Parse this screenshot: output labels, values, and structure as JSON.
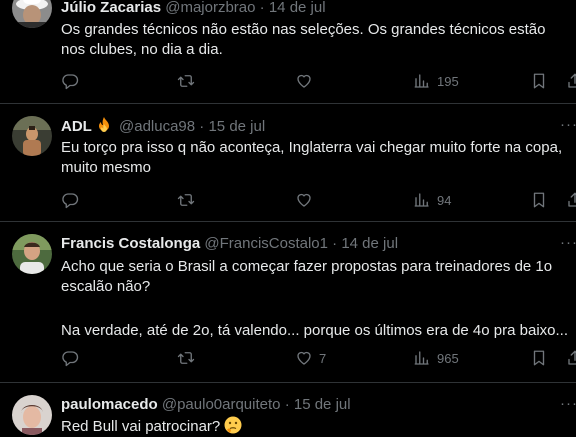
{
  "tweets": [
    {
      "name": "Júlio Zacarias",
      "handle": "@majorzbrao",
      "sep": "·",
      "date": "14 de jul",
      "more": "···",
      "lines": [
        "Os grandes técnicos não estão nas seleções. Os grandes técnicos estão",
        "nos clubes, no dia a dia."
      ],
      "replies": "",
      "retweets": "",
      "likes": "",
      "views": "195"
    },
    {
      "name": "ADL",
      "handle": "@adluca98",
      "sep": "·",
      "date": "15 de jul",
      "more": "···",
      "lines": [
        "Eu torço pra isso q não aconteça, Inglaterra vai chegar muito forte na copa,",
        "muito mesmo"
      ],
      "replies": "",
      "retweets": "",
      "likes": "",
      "views": "94"
    },
    {
      "name": "Francis Costalonga",
      "handle": "@FrancisCostalo1",
      "sep": "·",
      "date": "14 de jul",
      "more": "···",
      "lines": [
        "Acho que seria o Brasil a começar fazer propostas para treinadores de 1o",
        "escalão não?",
        "",
        "Na verdade, até de 2o, tá valendo... porque os últimos era de 4o pra baixo..."
      ],
      "replies": "",
      "retweets": "",
      "likes": "7",
      "views": "965"
    },
    {
      "name": "paulomacedo",
      "handle": "@paulo0arquiteto",
      "sep": "·",
      "date": "15 de jul",
      "more": "···",
      "lines": [
        "Red Bull vai patrocinar?"
      ]
    }
  ],
  "icons": {
    "reply": "reply-icon",
    "retweet": "retweet-icon",
    "like": "heart-icon",
    "views": "views-icon",
    "bookmark": "bookmark-icon",
    "fire": "fire-emoji",
    "thinking": "thinking-emoji"
  },
  "colors": {
    "background": "#000000",
    "text": "#e7e9ea",
    "muted": "#71767b",
    "divider": "#2f3336"
  }
}
